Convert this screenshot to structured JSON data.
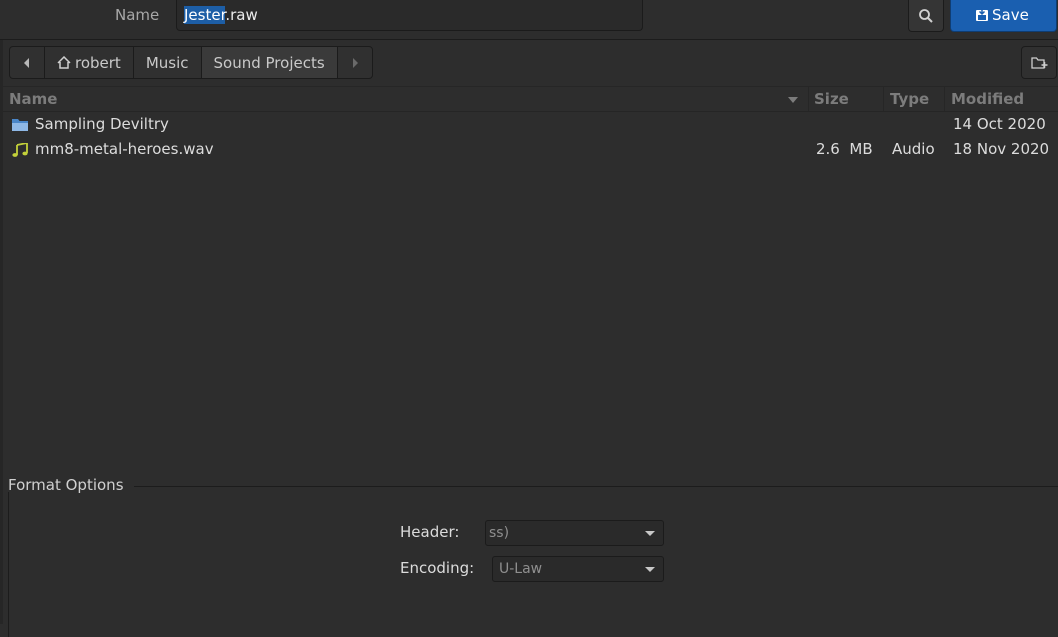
{
  "header": {
    "name_label": "Name",
    "filename_selected": "Jester",
    "filename_rest": ".raw",
    "search_icon": "search-icon",
    "save_label": "Save",
    "save_icon": "save-document-icon"
  },
  "pathbar": {
    "back_icon": "chevron-left-icon",
    "home_icon": "home-icon",
    "crumbs": [
      "robert",
      "Music",
      "Sound Projects"
    ],
    "forward_icon": "chevron-right-icon",
    "new_folder_icon": "new-folder-icon"
  },
  "file_list": {
    "columns": [
      "Name",
      "Size",
      "Type",
      "Modified"
    ],
    "sort_icon": "sort-descending-icon",
    "rows": [
      {
        "icon": "folder-icon",
        "name": "Sampling Deviltry",
        "size": "",
        "type": "",
        "modified": "14 Oct 2020"
      },
      {
        "icon": "audio-file-icon",
        "name": "mm8-metal-heroes.wav",
        "size": "2.6  MB",
        "type": "Audio",
        "modified": "18 Nov 2020"
      }
    ]
  },
  "format_options": {
    "title": "Format Options",
    "header_label": "Header:",
    "header_value": "ss)",
    "encoding_label": "Encoding:",
    "encoding_value": "U-Law"
  },
  "colors": {
    "accent": "#1a5fb0",
    "selection": "#1d5ea6",
    "background": "#2d2d2d"
  }
}
